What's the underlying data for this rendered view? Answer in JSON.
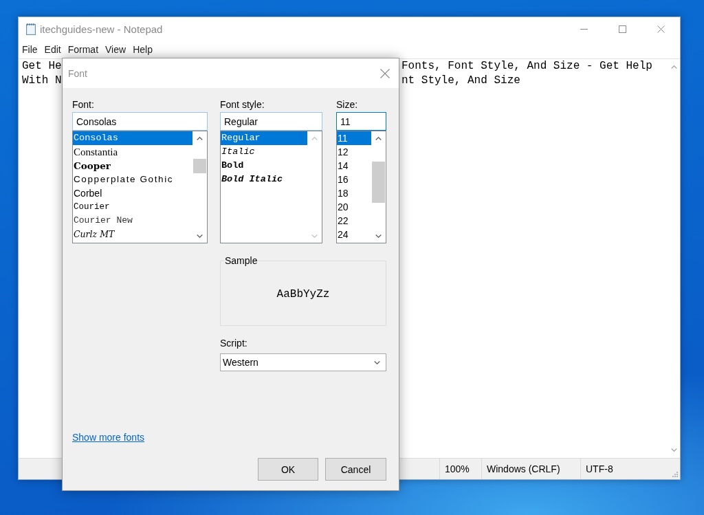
{
  "notepad": {
    "title": "itechguides-new - Notepad",
    "menu": [
      "File",
      "Edit",
      "Format",
      "View",
      "Help"
    ],
    "lines": [
      {
        "left": "Get He",
        "right": "Fonts, Font Style, And Size - Get Help"
      },
      {
        "left": "With N",
        "right": "nt Style, And Size"
      }
    ],
    "status_bar": [
      "100%",
      "Windows (CRLF)",
      "UTF-8"
    ]
  },
  "font_dialog": {
    "title": "Font",
    "columns": [
      {
        "label": "Font:",
        "value": "Consolas",
        "focused": false,
        "scrollbar_enabled": true,
        "items": [
          {
            "label": "Consolas",
            "kind": "mono",
            "selected": true
          },
          {
            "label": "Constantia",
            "kind": "serif",
            "selected": false
          },
          {
            "label": "Cooper",
            "kind": "heavy",
            "selected": false
          },
          {
            "label": "Copperplate Gothic",
            "kind": "caps",
            "selected": false
          },
          {
            "label": "Corbel",
            "kind": "sans",
            "selected": false
          },
          {
            "label": "Courier",
            "kind": "typewriter",
            "selected": false
          },
          {
            "label": "Courier New",
            "kind": "typewriter-light",
            "selected": false
          },
          {
            "label": "Curlz MT",
            "kind": "decorative",
            "selected": false
          }
        ]
      },
      {
        "label": "Font style:",
        "value": "Regular",
        "focused": false,
        "scrollbar_enabled": false,
        "items": [
          {
            "label": "Regular",
            "kind": "regular",
            "selected": true
          },
          {
            "label": "Italic",
            "kind": "italic",
            "selected": false
          },
          {
            "label": "Bold",
            "kind": "bold",
            "selected": false
          },
          {
            "label": "Bold Italic",
            "kind": "bold-italic",
            "selected": false
          }
        ]
      },
      {
        "label": "Size:",
        "value": "11",
        "focused": true,
        "scrollbar_enabled": true,
        "items": [
          {
            "label": "11",
            "selected": true
          },
          {
            "label": "12",
            "selected": false
          },
          {
            "label": "14",
            "selected": false
          },
          {
            "label": "16",
            "selected": false
          },
          {
            "label": "18",
            "selected": false
          },
          {
            "label": "20",
            "selected": false
          },
          {
            "label": "22",
            "selected": false
          },
          {
            "label": "24",
            "selected": false
          }
        ]
      }
    ],
    "sample": {
      "label": "Sample",
      "text": "AaBbYyZz"
    },
    "script": {
      "label": "Script:",
      "value": "Western"
    },
    "link": "Show more fonts",
    "buttons": [
      "OK",
      "Cancel"
    ]
  }
}
